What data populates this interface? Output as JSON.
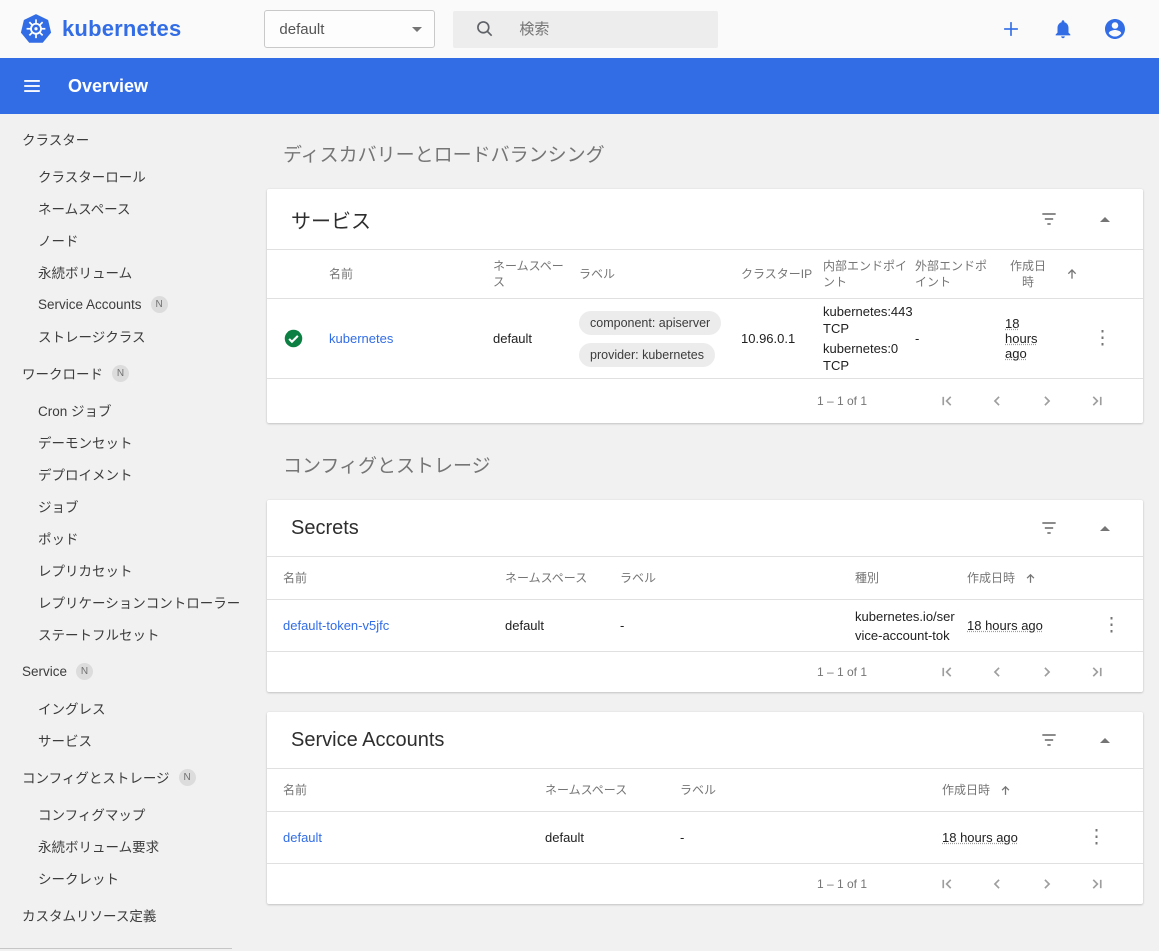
{
  "colors": {
    "brand_blue": "#326de6",
    "toolbar_blue": "#326de6",
    "link_blue": "#326de6",
    "status_green": "#0c8043",
    "background_gray": "#f1f1f1",
    "chip_gray": "#ececec"
  },
  "header": {
    "brand": "kubernetes",
    "namespace_select": {
      "value": "default"
    },
    "search": {
      "placeholder": "検索"
    }
  },
  "toolbar": {
    "title": "Overview"
  },
  "sidebar": {
    "items": [
      {
        "id": "cluster",
        "label": "クラスター",
        "type": "section"
      },
      {
        "id": "cluster-roles",
        "label": "クラスターロール",
        "type": "item"
      },
      {
        "id": "namespaces",
        "label": "ネームスペース",
        "type": "item"
      },
      {
        "id": "nodes",
        "label": "ノード",
        "type": "item"
      },
      {
        "id": "persistent-volumes",
        "label": "永続ボリューム",
        "type": "item"
      },
      {
        "id": "service-accounts",
        "label": "Service Accounts",
        "type": "item",
        "badge": "N"
      },
      {
        "id": "storage-classes",
        "label": "ストレージクラス",
        "type": "item"
      },
      {
        "id": "workloads",
        "label": "ワークロード",
        "type": "section",
        "badge": "N"
      },
      {
        "id": "cron-jobs",
        "label": "Cron ジョブ",
        "type": "item"
      },
      {
        "id": "daemon-sets",
        "label": "デーモンセット",
        "type": "item"
      },
      {
        "id": "deployments",
        "label": "デプロイメント",
        "type": "item"
      },
      {
        "id": "jobs",
        "label": "ジョブ",
        "type": "item"
      },
      {
        "id": "pods",
        "label": "ポッド",
        "type": "item"
      },
      {
        "id": "replica-sets",
        "label": "レプリカセット",
        "type": "item"
      },
      {
        "id": "replication-controllers",
        "label": "レプリケーションコントローラー",
        "type": "item"
      },
      {
        "id": "stateful-sets",
        "label": "ステートフルセット",
        "type": "item"
      },
      {
        "id": "service",
        "label": "Service",
        "type": "section",
        "badge": "N"
      },
      {
        "id": "ingresses",
        "label": "イングレス",
        "type": "item"
      },
      {
        "id": "services",
        "label": "サービス",
        "type": "item"
      },
      {
        "id": "config-and-storage",
        "label": "コンフィグとストレージ",
        "type": "section",
        "badge": "N"
      },
      {
        "id": "config-maps",
        "label": "コンフィグマップ",
        "type": "item"
      },
      {
        "id": "persistent-volume-claims",
        "label": "永続ボリューム要求",
        "type": "item"
      },
      {
        "id": "secrets",
        "label": "シークレット",
        "type": "item"
      },
      {
        "id": "custom-resource-definitions",
        "label": "カスタムリソース定義",
        "type": "section"
      }
    ]
  },
  "sections": {
    "discovery": {
      "title": "ディスカバリーとロードバランシング"
    },
    "config": {
      "title": "コンフィグとストレージ"
    }
  },
  "services_card": {
    "title": "サービス",
    "columns": [
      "名前",
      "ネームスペース",
      "ラベル",
      "クラスターIP",
      "内部エンドポイント",
      "外部エンドポイント",
      "作成日時"
    ],
    "row": {
      "status": "ok",
      "name": "kubernetes",
      "namespace": "default",
      "labels": [
        "component: apiserver",
        "provider: kubernetes"
      ],
      "cluster_ip": "10.96.0.1",
      "internal_endpoints": [
        "kubernetes:443 TCP",
        "kubernetes:0 TCP"
      ],
      "external_endpoints": "-",
      "created": "18 hours ago"
    },
    "pagination": {
      "range": "1 – 1 of 1"
    }
  },
  "secrets_card": {
    "title": "Secrets",
    "columns": [
      "名前",
      "ネームスペース",
      "ラベル",
      "種別",
      "作成日時"
    ],
    "row": {
      "name": "default-token-v5jfc",
      "namespace": "default",
      "labels": "-",
      "type": "kubernetes.io/service-account-token",
      "created": "18 hours ago"
    },
    "pagination": {
      "range": "1 – 1 of 1"
    }
  },
  "service_accounts_card": {
    "title": "Service Accounts",
    "columns": [
      "名前",
      "ネームスペース",
      "ラベル",
      "作成日時"
    ],
    "row": {
      "name": "default",
      "namespace": "default",
      "labels": "-",
      "created": "18 hours ago"
    },
    "pagination": {
      "range": "1 – 1 of 1"
    }
  }
}
